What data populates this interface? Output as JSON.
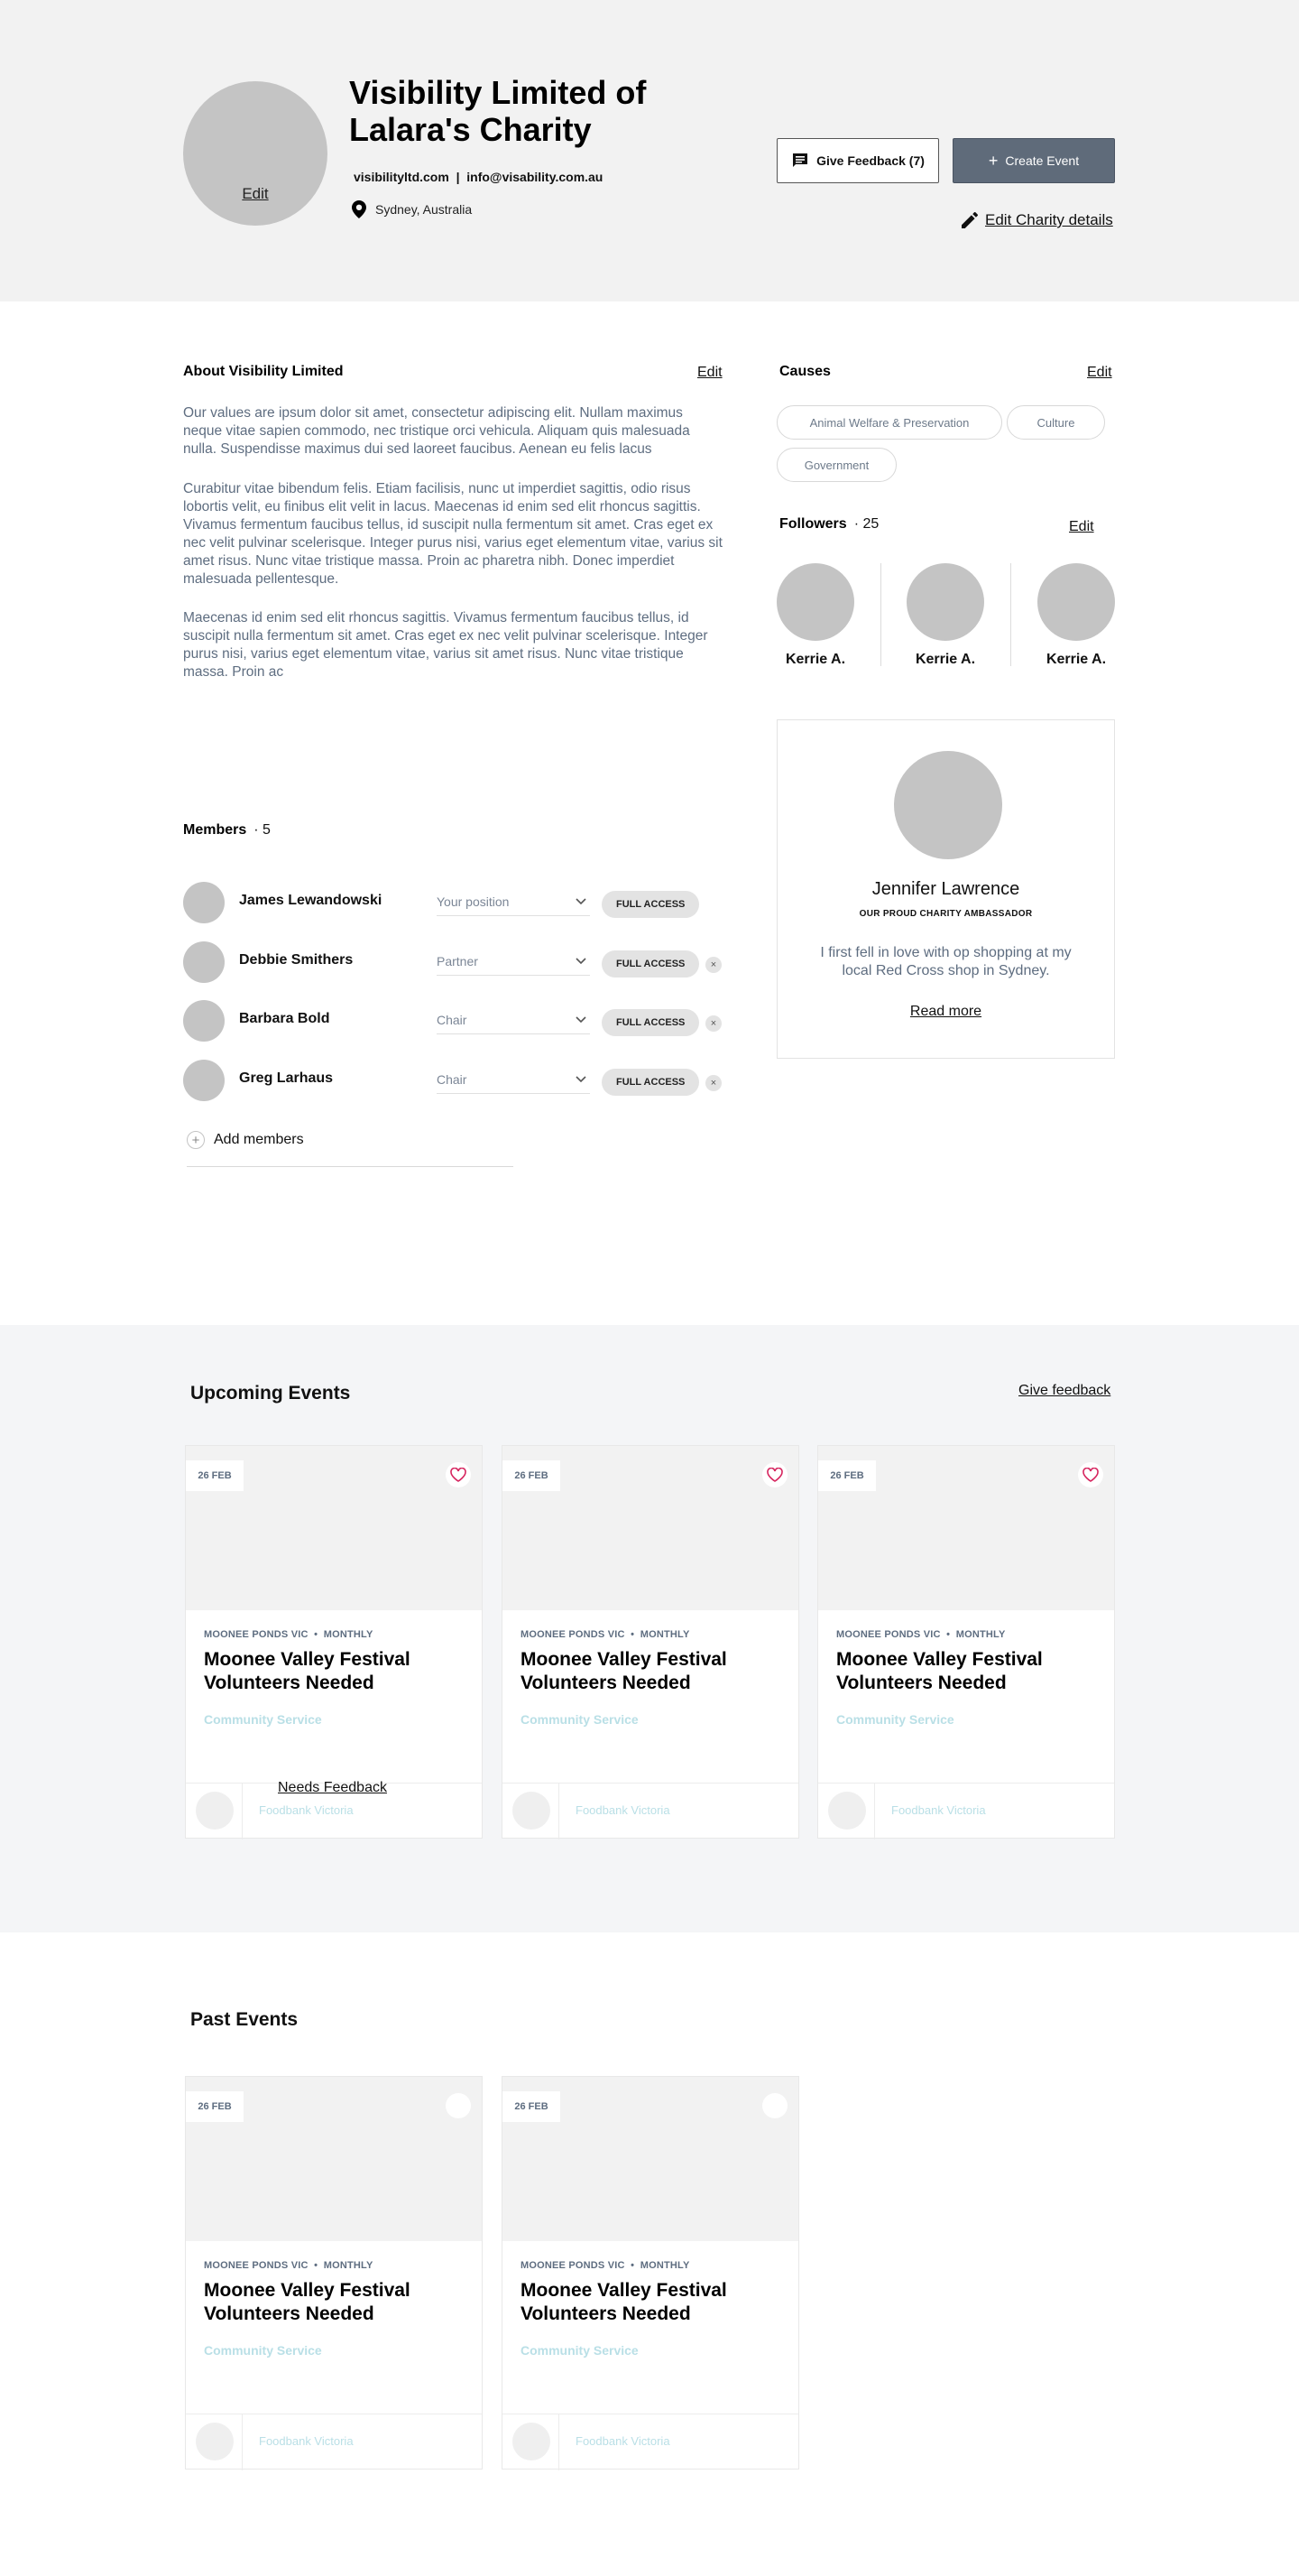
{
  "header": {
    "avatar_edit": "Edit",
    "title": "Visibility Limited of Lalara's Charity",
    "contact": "visibilityltd.com  |  info@visability.com.au",
    "location": "Sydney, Australia",
    "feedback_button": "Give Feedback (7)",
    "create_button": "Create Event",
    "edit_details": "Edit Charity details"
  },
  "about": {
    "heading": "About Visibility Limited",
    "edit": "Edit",
    "paragraphs": [
      "Our values are ipsum dolor sit amet, consectetur adipiscing elit. Nullam maximus neque vitae sapien commodo, nec tristique orci vehicula. Aliquam quis malesuada nulla. Suspendisse maximus dui sed laoreet faucibus. Aenean eu felis lacus",
      "Curabitur vitae bibendum felis. Etiam facilisis, nunc ut imperdiet sagittis, odio risus lobortis velit, eu finibus elit velit in lacus. Maecenas id enim sed elit rhoncus sagittis. Vivamus fermentum faucibus tellus, id suscipit nulla fermentum sit amet. Cras eget ex nec velit pulvinar scelerisque. Integer purus nisi, varius eget elementum vitae, varius sit amet risus. Nunc vitae tristique massa. Proin ac pharetra nibh. Donec imperdiet malesuada pellentesque.",
      "Maecenas id enim sed elit rhoncus sagittis. Vivamus fermentum faucibus tellus, id suscipit nulla fermentum sit amet. Cras eget ex nec velit pulvinar scelerisque. Integer purus nisi, varius eget elementum vitae, varius sit amet risus. Nunc vitae tristique massa. Proin ac"
    ]
  },
  "causes": {
    "heading": "Causes",
    "edit": "Edit",
    "items": [
      "Animal Welfare & Preservation",
      "Culture",
      "Government"
    ]
  },
  "followers": {
    "heading": "Followers",
    "count": "· 25",
    "edit": "Edit",
    "items": [
      "Kerrie A.",
      "Kerrie A.",
      "Kerrie A."
    ]
  },
  "ambassador": {
    "name": "Jennifer Lawrence",
    "subtitle": "OUR PROUD CHARITY AMBASSADOR",
    "quote": "I first fell in love with op shopping at my local Red Cross shop in Sydney.",
    "read_more": "Read more"
  },
  "members": {
    "heading": "Members",
    "count": "· 5",
    "items": [
      {
        "name": "James Lewandowski",
        "position": "Your position",
        "access": "FULL ACCESS"
      },
      {
        "name": "Debbie Smithers",
        "position": "Partner",
        "access": "FULL ACCESS"
      },
      {
        "name": "Barbara Bold",
        "position": "Chair",
        "access": "FULL ACCESS"
      },
      {
        "name": "Greg Larhaus",
        "position": "Chair",
        "access": "FULL ACCESS"
      }
    ],
    "remove_symbol": "×",
    "add": "Add members"
  },
  "upcoming": {
    "heading": "Upcoming Events",
    "feedback_link": "Give feedback",
    "needs_feedback": "Needs Feedback",
    "cards": [
      {
        "date": "26 FEB",
        "meta": "MOONEE PONDS VIC  •  MONTHLY",
        "title": "Moonee Valley Festival Volunteers Needed",
        "category": "Community Service",
        "org": "Foodbank Victoria"
      },
      {
        "date": "26 FEB",
        "meta": "MOONEE PONDS VIC  •  MONTHLY",
        "title": "Moonee Valley Festival Volunteers Needed",
        "category": "Community Service",
        "org": "Foodbank Victoria"
      },
      {
        "date": "26 FEB",
        "meta": "MOONEE PONDS VIC  •  MONTHLY",
        "title": "Moonee Valley Festival Volunteers Needed",
        "category": "Community Service",
        "org": "Foodbank Victoria"
      }
    ]
  },
  "past": {
    "heading": "Past Events",
    "cards": [
      {
        "date": "26 FEB",
        "meta": "MOONEE PONDS VIC  •  MONTHLY",
        "title": "Moonee Valley Festival Volunteers Needed",
        "category": "Community Service",
        "org": "Foodbank Victoria"
      },
      {
        "date": "26 FEB",
        "meta": "MOONEE PONDS VIC  •  MONTHLY",
        "title": "Moonee Valley Festival Volunteers Needed",
        "category": "Community Service",
        "org": "Foodbank Victoria"
      }
    ]
  },
  "colors": {
    "header_bg": "#f2f2f2",
    "primary_button": "#5f6b7a",
    "body_text": "#5e6d80",
    "heart": "#d6245e",
    "category_text": "#b9dfe6",
    "events_band": "#f4f5f7"
  },
  "icons": {
    "feedback": "chat-bubble-icon",
    "create": "plus-icon",
    "edit_details": "pencil-icon",
    "location": "map-pin-icon",
    "favorite": "heart-icon",
    "dropdown": "chevron-down-icon",
    "remove": "close-icon",
    "add": "plus-circle-icon"
  }
}
